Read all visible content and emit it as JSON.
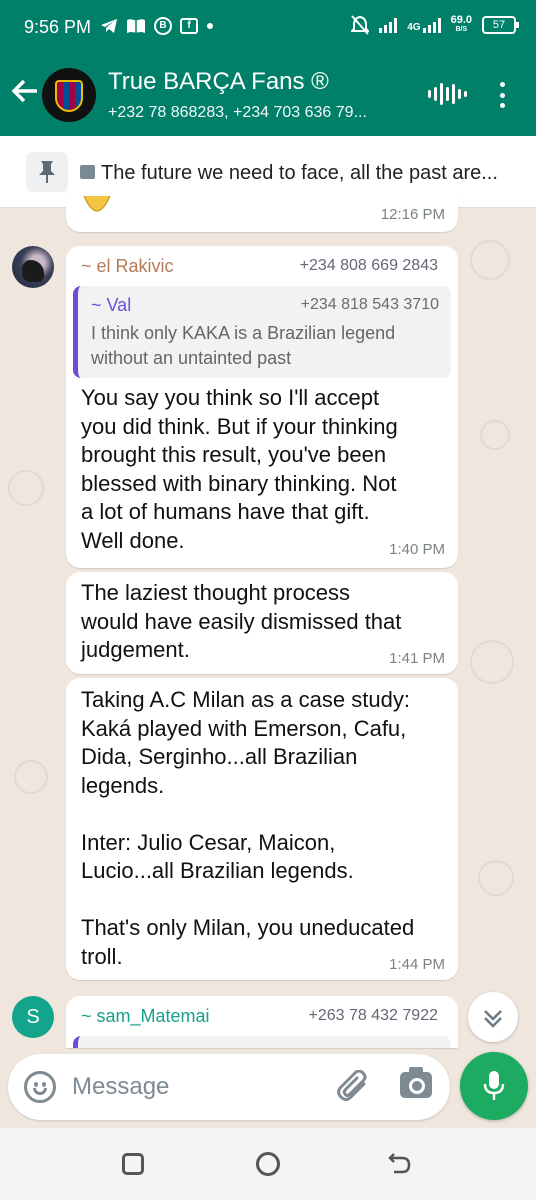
{
  "status_bar": {
    "time": "9:56 PM",
    "net_speed_value": "69.0",
    "net_speed_unit": "B/S",
    "network_type": "4G",
    "battery": "57",
    "icons": [
      "telegram-icon",
      "book-icon",
      "bitcoin-icon",
      "facebook-icon",
      "dot-icon",
      "muted-bell-icon",
      "signal-icon",
      "signal-4g-icon",
      "battery-icon"
    ]
  },
  "header": {
    "title": "True BARÇA Fans ®",
    "subtitle": "+232 78 868283, +234 703 636 79...",
    "accent_color": "#008069"
  },
  "pinned": {
    "text": "The future we need to face, all the past are..."
  },
  "chat": {
    "partial_top_time": "12:16 PM",
    "messages": [
      {
        "sender": "~ el Rakivic",
        "phone": "+234 808 669 2843",
        "quote_sender": "~ Val",
        "quote_phone": "+234 818 543 3710",
        "quote_lines": [
          "I think only KAKA is a Brazilian legend",
          "without an untainted past"
        ],
        "lines": [
          "You say you think so I'll accept",
          "you did think. But if your thinking",
          "brought this result, you've been",
          "blessed with binary thinking. Not",
          "a lot of humans have that gift.",
          "Well done."
        ],
        "time": "1:40 PM"
      },
      {
        "lines": [
          "The laziest thought process",
          "would have easily dismissed that",
          "judgement."
        ],
        "time": "1:41 PM"
      },
      {
        "lines": [
          "Taking A.C Milan as a case study:",
          "Kaká played with Emerson, Cafu,",
          "Dida, Serginho...all Brazilian",
          "legends.",
          "",
          "Inter: Julio Cesar, Maicon,",
          "Lucio...all Brazilian legends.",
          "",
          "That's only Milan, you uneducated",
          "troll."
        ],
        "time": "1:44 PM"
      },
      {
        "sender": "~ sam_Matemai",
        "phone": "+263 78 432 7922",
        "avatar_letter": "S"
      }
    ]
  },
  "composer": {
    "placeholder": "Message"
  }
}
